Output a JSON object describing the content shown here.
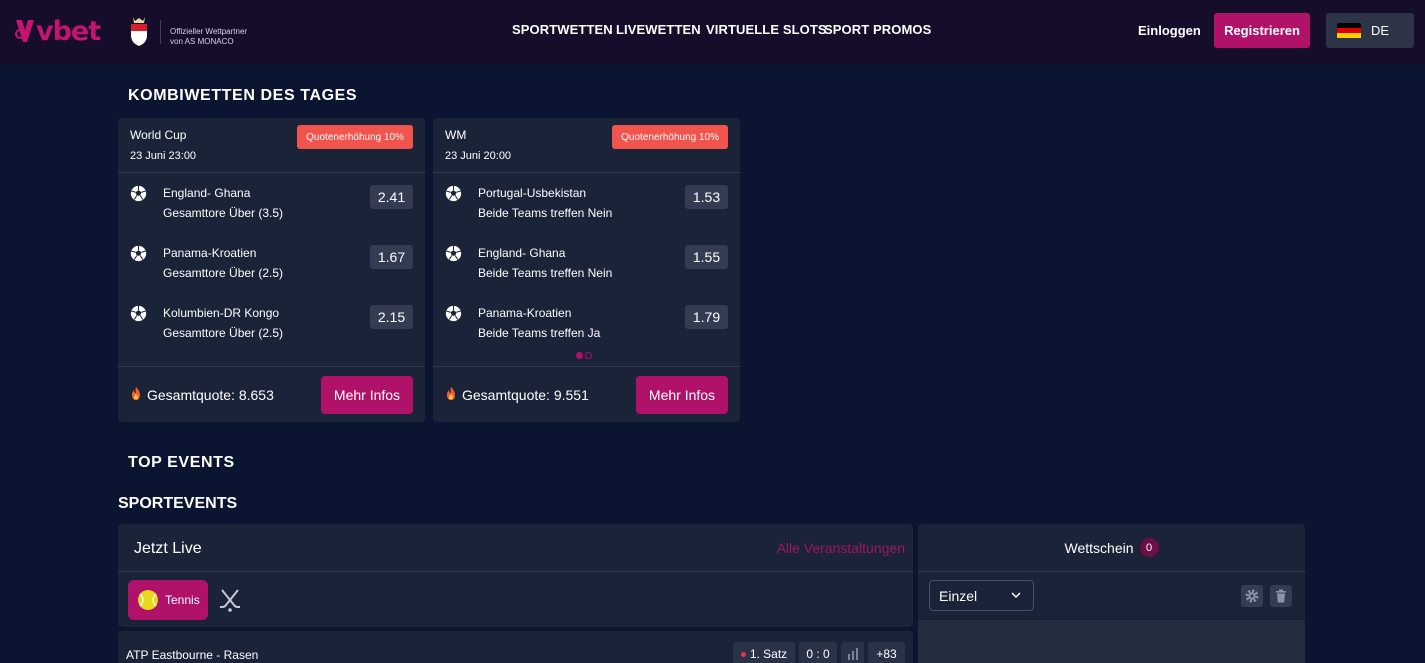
{
  "header": {
    "logo_text": "vbet",
    "partner_line1": "Offizieller Wettpartner",
    "partner_line2": "von AS MONACO",
    "nav": [
      "SPORTWETTEN",
      "LIVEWETTEN",
      "VIRTUELLE SLOTS",
      "SPORT PROMOS"
    ],
    "login_label": "Einloggen",
    "register_label": "Registrieren",
    "language": "DE"
  },
  "kombi": {
    "title": "KOMBIWETTEN DES TAGES",
    "cards": [
      {
        "title": "World Cup",
        "date": "23 Juni 23:00",
        "badge": "Quotenerhöhung 10%",
        "picks": [
          {
            "match": "England- Ghana",
            "market": "Gesamttore Über (3.5)",
            "odd": "2.41"
          },
          {
            "match": "Panama-Kroatien",
            "market": "Gesamttore Über (2.5)",
            "odd": "1.67"
          },
          {
            "match": "Kolumbien-DR Kongo",
            "market": "Gesamttore Über (2.5)",
            "odd": "2.15"
          }
        ],
        "total": "Gesamtquote: 8.653",
        "button": "Mehr Infos"
      },
      {
        "title": "WM",
        "date": "23 Juni 20:00",
        "badge": "Quotenerhöhung 10%",
        "picks": [
          {
            "match": "Portugal-Usbekistan",
            "market": "Beide Teams treffen Nein",
            "odd": "1.53"
          },
          {
            "match": "England- Ghana",
            "market": "Beide Teams treffen Nein",
            "odd": "1.55"
          },
          {
            "match": "Panama-Kroatien",
            "market": "Beide Teams treffen Ja",
            "odd": "1.79"
          }
        ],
        "total": "Gesamtquote: 9.551",
        "button": "Mehr Infos"
      }
    ]
  },
  "top_events_title": "TOP EVENTS",
  "sportevents_title": "SPORTEVENTS",
  "live": {
    "title": "Jetzt Live",
    "all_events": "Alle Veranstaltungen",
    "sport_chip": "Tennis",
    "match": {
      "name": "ATP Eastbourne - Rasen",
      "period": "1. Satz",
      "score": "0 : 0",
      "more": "+83"
    }
  },
  "betslip": {
    "title": "Wettschein",
    "count": "0",
    "type": "Einzel"
  },
  "colors": {
    "background": "#0b1430",
    "header": "#150d2a",
    "brand": "#b0126a",
    "badge": "#f0544c",
    "card": "#1a2338"
  }
}
